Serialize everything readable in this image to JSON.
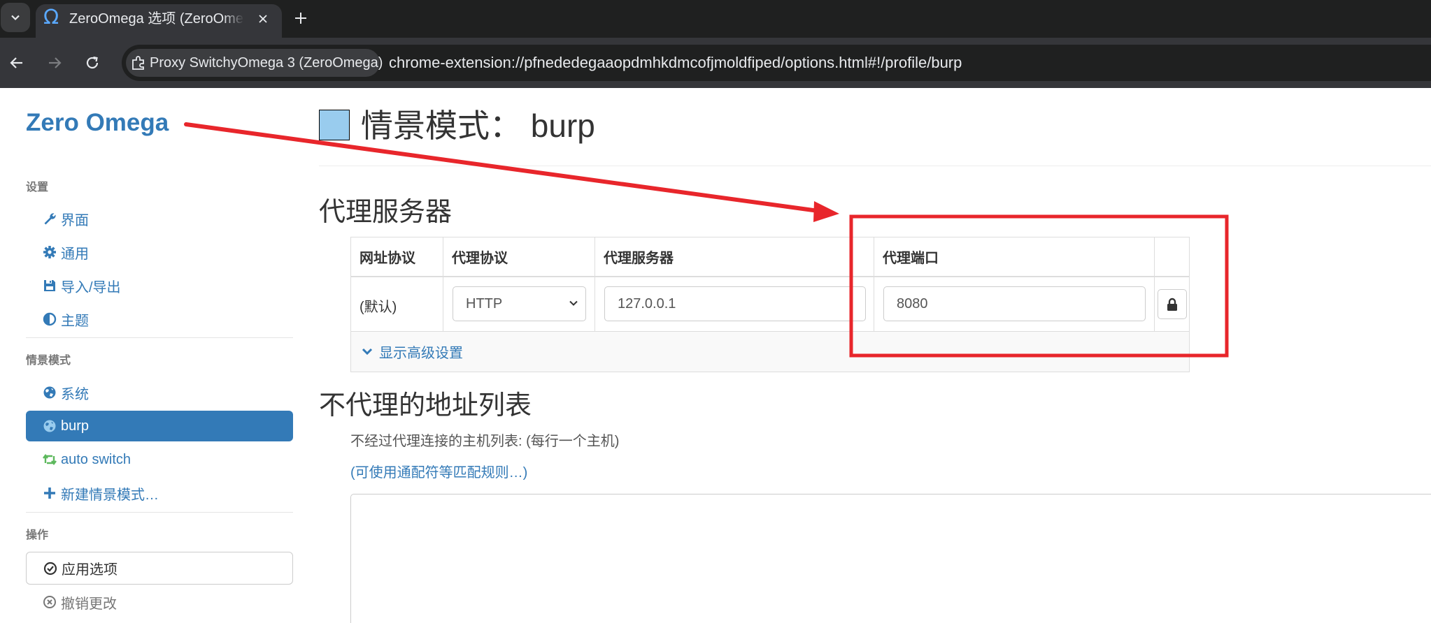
{
  "browser": {
    "tab_title": "ZeroOmega 选项 (ZeroOmega)",
    "tab_favicon": "omega-icon",
    "site_chip_label": "Proxy SwitchyOmega 3 (ZeroOmega)",
    "url": "chrome-extension://pfnededegaaopdmhkdmcofjmoldfiped/options.html#!/profile/burp"
  },
  "sidebar": {
    "brand": "Zero Omega",
    "settings_header": "设置",
    "settings_items": [
      {
        "label": "界面",
        "icon": "wrench-icon"
      },
      {
        "label": "通用",
        "icon": "gear-icon"
      },
      {
        "label": "导入/导出",
        "icon": "save-icon"
      },
      {
        "label": "主题",
        "icon": "contrast-icon"
      }
    ],
    "profiles_header": "情景模式",
    "profile_items": [
      {
        "label": "系统",
        "icon": "globe-icon"
      },
      {
        "label": "burp",
        "icon": "globe-icon",
        "active": true
      },
      {
        "label": "auto switch",
        "icon": "retweet-icon"
      },
      {
        "label": "新建情景模式…",
        "icon": "plus-icon"
      }
    ],
    "actions_header": "操作",
    "apply_label": "应用选项",
    "discard_label": "撤销更改"
  },
  "profile": {
    "title": "情景模式： burp",
    "color": "#99ccee"
  },
  "proxy_section": {
    "title": "代理服务器",
    "columns": [
      "网址协议",
      "代理协议",
      "代理服务器",
      "代理端口"
    ],
    "row": {
      "scheme": "(默认)",
      "protocol": "HTTP",
      "server": "127.0.0.1",
      "port": "8080"
    },
    "advanced_link": "显示高级设置"
  },
  "bypass_section": {
    "title": "不代理的地址列表",
    "help": "不经过代理连接的主机列表: (每行一个主机)",
    "wildcard_link": "(可使用通配符等匹配规则…)",
    "value": ""
  },
  "colors": {
    "accent": "#337ab7",
    "annotation": "#e8262b"
  }
}
